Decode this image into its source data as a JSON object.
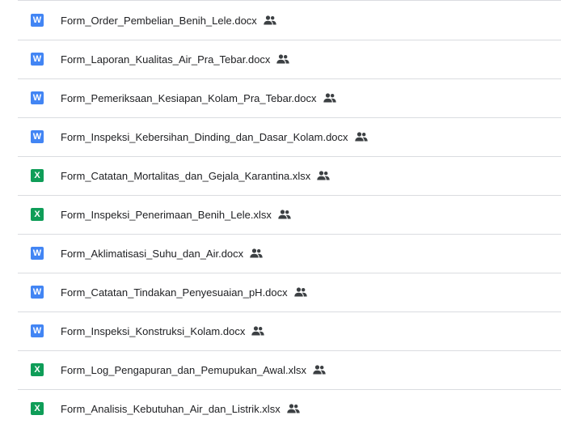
{
  "colors": {
    "word": "#4285f4",
    "excel": "#0f9d58",
    "text": "#202124",
    "divider": "#dadce0",
    "shared_icon": "#3c4043"
  },
  "files": [
    {
      "type": "word",
      "icon_letter": "W",
      "icon": "word-doc-icon",
      "name": "Form_Order_Pembelian_Benih_Lele.docx",
      "shared": true
    },
    {
      "type": "word",
      "icon_letter": "W",
      "icon": "word-doc-icon",
      "name": "Form_Laporan_Kualitas_Air_Pra_Tebar.docx",
      "shared": true
    },
    {
      "type": "word",
      "icon_letter": "W",
      "icon": "word-doc-icon",
      "name": "Form_Pemeriksaan_Kesiapan_Kolam_Pra_Tebar.docx",
      "shared": true
    },
    {
      "type": "word",
      "icon_letter": "W",
      "icon": "word-doc-icon",
      "name": "Form_Inspeksi_Kebersihan_Dinding_dan_Dasar_Kolam.docx",
      "shared": true
    },
    {
      "type": "excel",
      "icon_letter": "X",
      "icon": "excel-sheet-icon",
      "name": "Form_Catatan_Mortalitas_dan_Gejala_Karantina.xlsx",
      "shared": true
    },
    {
      "type": "excel",
      "icon_letter": "X",
      "icon": "excel-sheet-icon",
      "name": "Form_Inspeksi_Penerimaan_Benih_Lele.xlsx",
      "shared": true
    },
    {
      "type": "word",
      "icon_letter": "W",
      "icon": "word-doc-icon",
      "name": "Form_Aklimatisasi_Suhu_dan_Air.docx",
      "shared": true
    },
    {
      "type": "word",
      "icon_letter": "W",
      "icon": "word-doc-icon",
      "name": "Form_Catatan_Tindakan_Penyesuaian_pH.docx",
      "shared": true
    },
    {
      "type": "word",
      "icon_letter": "W",
      "icon": "word-doc-icon",
      "name": "Form_Inspeksi_Konstruksi_Kolam.docx",
      "shared": true
    },
    {
      "type": "excel",
      "icon_letter": "X",
      "icon": "excel-sheet-icon",
      "name": "Form_Log_Pengapuran_dan_Pemupukan_Awal.xlsx",
      "shared": true
    },
    {
      "type": "excel",
      "icon_letter": "X",
      "icon": "excel-sheet-icon",
      "name": "Form_Analisis_Kebutuhan_Air_dan_Listrik.xlsx",
      "shared": true
    }
  ]
}
